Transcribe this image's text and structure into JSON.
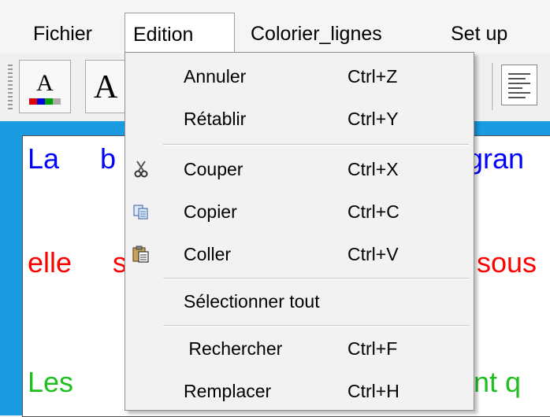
{
  "menubar": {
    "items": [
      "Fichier",
      "Edition",
      "Colorier_lignes",
      "Set up"
    ]
  },
  "toolbar": {
    "font_color_letter": "A",
    "font_letter": "A",
    "color_swatches": [
      "#e00000",
      "#0000e0",
      "#00a000",
      "#aaaaaa"
    ]
  },
  "editor": {
    "lines": [
      {
        "left": "La",
        "mid": "b",
        "right": "gran",
        "color": "#0000ff"
      },
      {
        "left": "elle",
        "mid": "s",
        "right": "sous",
        "color": "#ff0000"
      },
      {
        "left": "Les",
        "mid": "",
        "right": "nt  q",
        "color": "#1fbf1f"
      }
    ]
  },
  "edit_menu": {
    "items": [
      {
        "label": "Annuler",
        "shortcut": "Ctrl+Z",
        "icon": ""
      },
      {
        "label": "Rétablir",
        "shortcut": "Ctrl+Y",
        "icon": ""
      },
      {
        "label": "Couper",
        "shortcut": "Ctrl+X",
        "icon": "scissors-icon"
      },
      {
        "label": "Copier",
        "shortcut": "Ctrl+C",
        "icon": "copy-icon"
      },
      {
        "label": "Coller",
        "shortcut": "Ctrl+V",
        "icon": "paste-icon"
      },
      {
        "label": "Sélectionner tout",
        "shortcut": "",
        "icon": ""
      },
      {
        "label": " Rechercher",
        "shortcut": "Ctrl+F",
        "icon": ""
      },
      {
        "label": "Remplacer",
        "shortcut": "Ctrl+H",
        "icon": ""
      }
    ]
  }
}
